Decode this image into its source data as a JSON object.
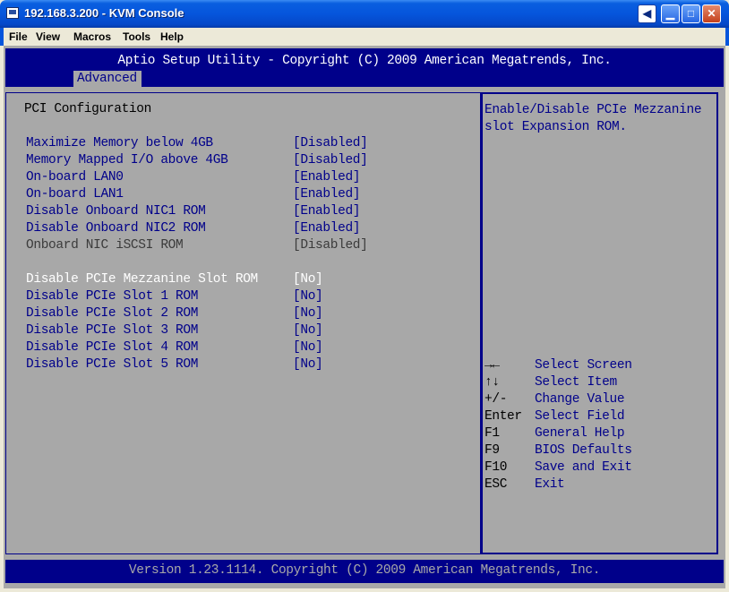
{
  "window": {
    "title": "192.168.3.200 - KVM Console",
    "icon": "monitor-icon"
  },
  "menubar": {
    "items": [
      "File",
      "View",
      "Macros",
      "Tools",
      "Help"
    ]
  },
  "bios": {
    "header_title": "Aptio Setup Utility - Copyright (C) 2009 American Megatrends, Inc.",
    "active_tab": "Advanced",
    "section_title": "PCI Configuration",
    "items": [
      {
        "label": "Maximize Memory below 4GB",
        "value": "[Disabled]",
        "state": "normal"
      },
      {
        "label": "Memory Mapped I/O above 4GB",
        "value": "[Disabled]",
        "state": "normal"
      },
      {
        "label": "On-board LAN0",
        "value": "[Enabled]",
        "state": "normal"
      },
      {
        "label": "On-board LAN1",
        "value": "[Enabled]",
        "state": "normal"
      },
      {
        "label": "Disable Onboard NIC1 ROM",
        "value": "[Enabled]",
        "state": "normal"
      },
      {
        "label": "Disable Onboard NIC2 ROM",
        "value": "[Enabled]",
        "state": "normal"
      },
      {
        "label": "Onboard NIC iSCSI ROM",
        "value": "[Disabled]",
        "state": "disabled"
      },
      {
        "label": "Disable PCIe Mezzanine Slot ROM",
        "value": "[No]",
        "state": "selected"
      },
      {
        "label": "Disable PCIe Slot 1 ROM",
        "value": "[No]",
        "state": "normal"
      },
      {
        "label": "Disable PCIe Slot 2 ROM",
        "value": "[No]",
        "state": "normal"
      },
      {
        "label": "Disable PCIe Slot 3 ROM",
        "value": "[No]",
        "state": "normal"
      },
      {
        "label": "Disable PCIe Slot 4 ROM",
        "value": "[No]",
        "state": "normal"
      },
      {
        "label": "Disable PCIe Slot 5 ROM",
        "value": "[No]",
        "state": "normal"
      }
    ],
    "help_lines": [
      "Enable/Disable PCIe Mezzanine",
      "slot Expansion ROM."
    ],
    "keys": [
      {
        "key": "→←",
        "desc": "Select Screen"
      },
      {
        "key": "↑↓",
        "desc": "Select Item"
      },
      {
        "key": "+/-",
        "desc": "Change Value"
      },
      {
        "key": "Enter",
        "desc": "Select Field"
      },
      {
        "key": "F1",
        "desc": "General Help"
      },
      {
        "key": "F9",
        "desc": "BIOS Defaults"
      },
      {
        "key": "F10",
        "desc": "Save and Exit"
      },
      {
        "key": "ESC",
        "desc": "Exit"
      }
    ],
    "footer": "Version 1.23.1114. Copyright (C) 2009 American Megatrends, Inc."
  },
  "colors": {
    "bios_blue": "#00008a",
    "bios_gray": "#a8a8a8",
    "selected_text": "#ffffff",
    "disabled_text": "#3b3b3b"
  }
}
